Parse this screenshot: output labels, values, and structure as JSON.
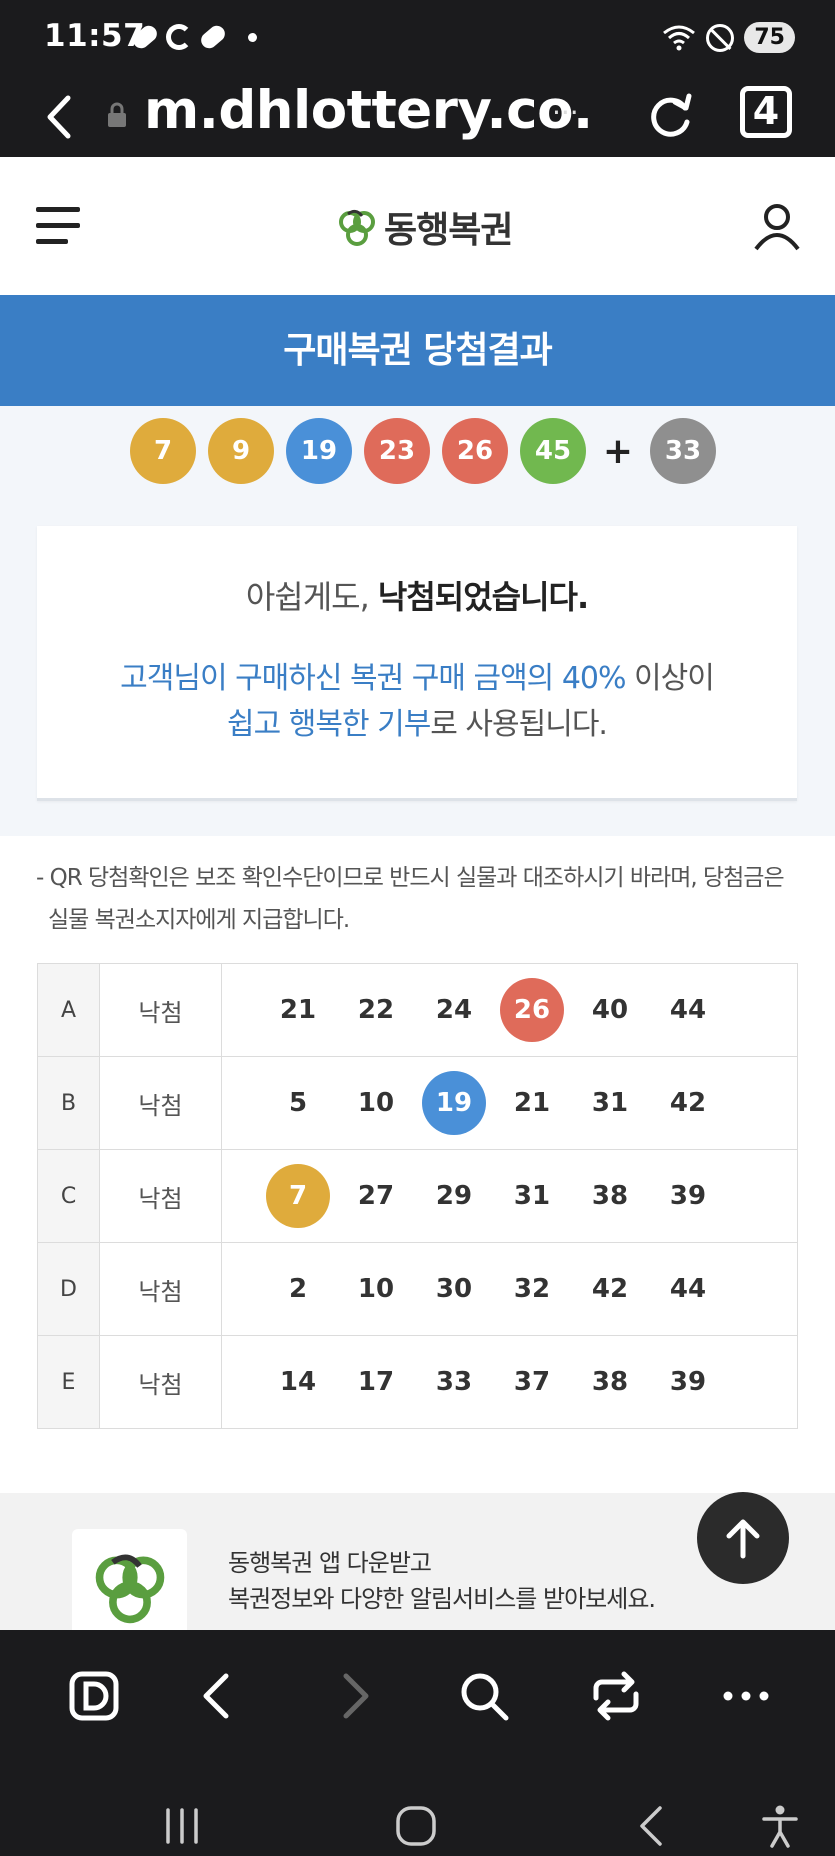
{
  "status_bar": {
    "time": "11:57",
    "battery": "75"
  },
  "browser": {
    "url": "m.dhlottery.co.",
    "more": "···",
    "tab_count": "4"
  },
  "site": {
    "logo_text": "동행복권"
  },
  "page_title": "구매복권 당첨결과",
  "winning_numbers": [
    {
      "n": "7",
      "color": "#dfab3c"
    },
    {
      "n": "9",
      "color": "#dfab3c"
    },
    {
      "n": "19",
      "color": "#4a90d8"
    },
    {
      "n": "23",
      "color": "#df6b5a"
    },
    {
      "n": "26",
      "color": "#df6b5a"
    },
    {
      "n": "45",
      "color": "#71b84f"
    }
  ],
  "plus_sign": "+",
  "bonus_number": {
    "n": "33",
    "color": "#8f8f8f"
  },
  "result": {
    "prefix": "아쉽게도, ",
    "bold": "낙첨되었습니다.",
    "donation_blue_1": "고객님이 구매하신 복권 구매 금액의 40%",
    "donation_plain_1": " 이상이",
    "donation_blue_2": "쉽고 행복한 기부",
    "donation_plain_2": "로 사용됩니다."
  },
  "notice_line_1": "- QR 당첨확인은 보조 확인수단이므로 반드시 실물과 대조하시기 바라며, 당첨금은",
  "notice_line_2": "실물 복권소지자에게 지급합니다.",
  "games": [
    {
      "label": "A",
      "result": "낙첨",
      "numbers": [
        {
          "n": "21"
        },
        {
          "n": "22"
        },
        {
          "n": "24"
        },
        {
          "n": "26",
          "hit": "#df6b5a"
        },
        {
          "n": "40"
        },
        {
          "n": "44"
        }
      ]
    },
    {
      "label": "B",
      "result": "낙첨",
      "numbers": [
        {
          "n": "5"
        },
        {
          "n": "10"
        },
        {
          "n": "19",
          "hit": "#4a90d8"
        },
        {
          "n": "21"
        },
        {
          "n": "31"
        },
        {
          "n": "42"
        }
      ]
    },
    {
      "label": "C",
      "result": "낙첨",
      "numbers": [
        {
          "n": "7",
          "hit": "#dfab3c"
        },
        {
          "n": "27"
        },
        {
          "n": "29"
        },
        {
          "n": "31"
        },
        {
          "n": "38"
        },
        {
          "n": "39"
        }
      ]
    },
    {
      "label": "D",
      "result": "낙첨",
      "numbers": [
        {
          "n": "2"
        },
        {
          "n": "10"
        },
        {
          "n": "30"
        },
        {
          "n": "32"
        },
        {
          "n": "42"
        },
        {
          "n": "44"
        }
      ]
    },
    {
      "label": "E",
      "result": "낙첨",
      "numbers": [
        {
          "n": "14"
        },
        {
          "n": "17"
        },
        {
          "n": "33"
        },
        {
          "n": "37"
        },
        {
          "n": "38"
        },
        {
          "n": "39"
        }
      ]
    }
  ],
  "app_promo": {
    "line_1": "동행복권 앱 다운받고",
    "line_2": "복권정보와 다양한 알림서비스를 받아보세요."
  },
  "colors": {
    "brand_blue": "#3a7ec5",
    "logo_green": "#5a9e3f"
  }
}
